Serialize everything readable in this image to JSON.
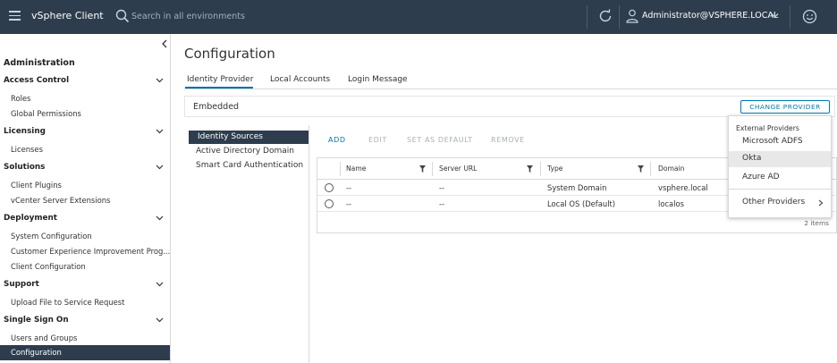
{
  "header": {
    "app_title": "vSphere Client",
    "search_placeholder": "Search in all environments",
    "user": "Administrator@VSPHERE.LOCAL"
  },
  "sidebar": {
    "title": "Administration",
    "sections": [
      {
        "label": "Access Control",
        "items": [
          "Roles",
          "Global Permissions"
        ]
      },
      {
        "label": "Licensing",
        "items": [
          "Licenses"
        ]
      },
      {
        "label": "Solutions",
        "items": [
          "Client Plugins",
          "vCenter Server Extensions"
        ]
      },
      {
        "label": "Deployment",
        "items": [
          "System Configuration",
          "Customer Experience Improvement Prog...",
          "Client Configuration"
        ]
      },
      {
        "label": "Support",
        "items": [
          "Upload File to Service Request"
        ]
      },
      {
        "label": "Single Sign On",
        "items": [
          "Users and Groups",
          "Configuration"
        ]
      }
    ],
    "active_item": "Configuration"
  },
  "main": {
    "title": "Configuration",
    "tabs": [
      "Identity Provider",
      "Local Accounts",
      "Login Message"
    ],
    "active_tab": "Identity Provider",
    "provider_label": "Embedded",
    "change_provider_button": "CHANGE PROVIDER",
    "subnav": [
      "Identity Sources",
      "Active Directory Domain",
      "Smart Card Authentication"
    ],
    "actions": {
      "add": "ADD",
      "edit": "EDIT",
      "set_default": "SET AS DEFAULT",
      "remove": "REMOVE"
    },
    "table": {
      "columns": [
        "Name",
        "Server URL",
        "Type",
        "Domain"
      ],
      "rows": [
        {
          "name": "--",
          "server_url": "--",
          "type": "System Domain",
          "domain": "vsphere.local"
        },
        {
          "name": "--",
          "server_url": "--",
          "type": "Local OS (Default)",
          "domain": "localos"
        }
      ],
      "count": "2 items"
    }
  },
  "dropdown": {
    "header": "External Providers",
    "items": [
      "Microsoft ADFS",
      "Okta",
      "Azure AD"
    ],
    "hovered_item": "Okta",
    "other": "Other Providers"
  },
  "colors": {
    "header_bg": "#2e3d4e",
    "accent": "#0079b8",
    "active_bg": "#2e3d4e"
  }
}
